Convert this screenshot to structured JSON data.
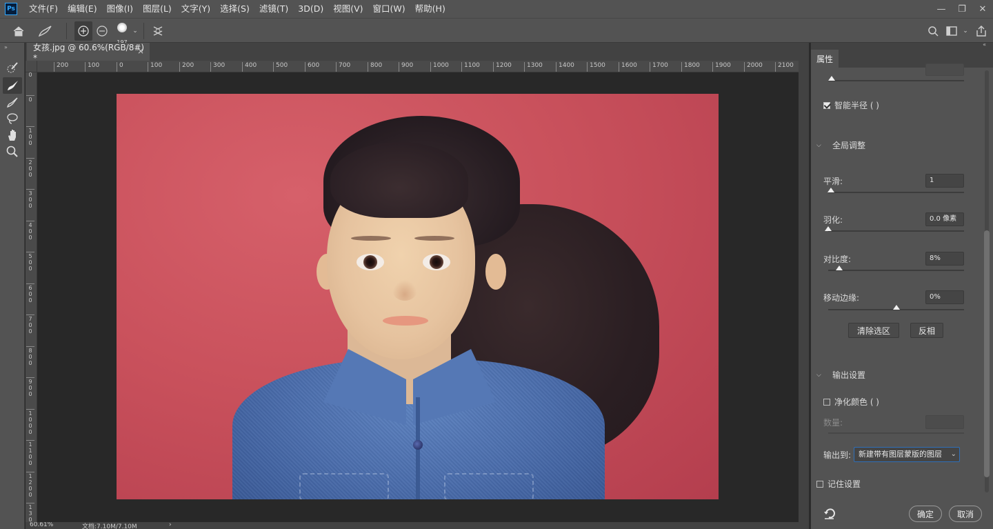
{
  "menubar": {
    "logo": "Ps",
    "items": [
      "文件(F)",
      "编辑(E)",
      "图像(I)",
      "图层(L)",
      "文字(Y)",
      "选择(S)",
      "滤镜(T)",
      "3D(D)",
      "视图(V)",
      "窗口(W)",
      "帮助(H)"
    ],
    "window_buttons": [
      "—",
      "❐",
      "✕"
    ]
  },
  "options": {
    "brush_size": "197"
  },
  "document": {
    "tab_title": "女孩.jpg @ 60.6%(RGB/8#) *",
    "tab_close": "×"
  },
  "ruler": {
    "h_ticks": [
      "200",
      "100",
      "0",
      "100",
      "200",
      "300",
      "400",
      "500",
      "600",
      "700",
      "800",
      "900",
      "1000",
      "1100",
      "1200",
      "1300",
      "1400",
      "1500",
      "1600",
      "1700",
      "1800",
      "1900",
      "2000",
      "2100"
    ],
    "v_ticks": [
      "0",
      "0",
      "1\n0\n0",
      "2\n0\n0",
      "3\n0\n0",
      "4\n0\n0",
      "5\n0\n0",
      "6\n0\n0",
      "7\n0\n0",
      "8\n0\n0",
      "9\n0\n0",
      "1\n0\n0\n0",
      "1\n1\n0\n0",
      "1\n2\n0\n0",
      "1\n3\n0"
    ]
  },
  "status": {
    "zoom": "60.61%",
    "doc_size": "文档:7.10M/7.10M",
    "arrow": "›"
  },
  "panel": {
    "tab": "属性",
    "smart_radius": {
      "label": "智能半径 (  )",
      "checked": true
    },
    "global_adjust": {
      "title": "全局调整",
      "smooth": {
        "label": "平滑:",
        "value": "1",
        "position": 0.02
      },
      "feather": {
        "label": "羽化:",
        "value": "0.0 像素",
        "position": 0.0
      },
      "contrast": {
        "label": "对比度:",
        "value": "8%",
        "position": 0.08
      },
      "shift_edge": {
        "label": "移动边缘:",
        "value": "0%",
        "position": 0.5
      }
    },
    "clear_selection": "清除选区",
    "invert": "反相",
    "output": {
      "title": "输出设置",
      "decontaminate": {
        "label": "净化颜色 (  )",
        "checked": false
      },
      "amount_label": "数量:",
      "output_to_label": "输出到:",
      "output_to_value": "新建带有图层蒙版的图层"
    },
    "remember": {
      "label": "记住设置",
      "checked": false
    },
    "ok": "确定",
    "cancel": "取消"
  },
  "colors": {
    "ui_bg": "#535353",
    "canvas_bg": "#282828",
    "accent_blue": "#2f6fb8",
    "photo_background": "#c9515c"
  }
}
